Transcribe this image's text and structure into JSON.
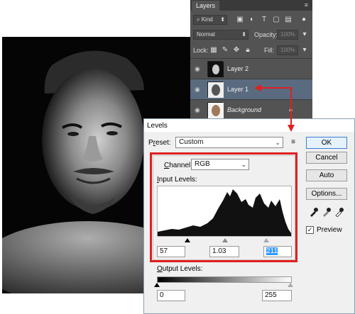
{
  "layers_panel": {
    "tab": "Layers",
    "filter_kind": "Kind",
    "blend_mode": "Normal",
    "opacity_label": "Opacity:",
    "opacity_value": "100%",
    "lock_label": "Lock:",
    "fill_label": "Fill:",
    "fill_value": "100%",
    "layers": [
      {
        "name": "Layer 2",
        "selected": false,
        "italic": false
      },
      {
        "name": "Layer 1",
        "selected": true,
        "italic": false
      },
      {
        "name": "Background",
        "selected": false,
        "italic": true
      }
    ]
  },
  "levels": {
    "title": "Levels",
    "preset_label_pre": "P",
    "preset_label_ul": "r",
    "preset_label_post": "eset:",
    "preset_value": "Custom",
    "channel_label_pre": "",
    "channel_label_ul": "C",
    "channel_label_post": "hannel:",
    "channel_value": "RGB",
    "input_levels_label_pre": "",
    "input_levels_label_ul": "I",
    "input_levels_label_post": "nput Levels:",
    "input_black": "57",
    "input_gamma": "1.03",
    "input_white": "211",
    "output_levels_label_pre": "",
    "output_levels_label_ul": "O",
    "output_levels_label_post": "utput Levels:",
    "output_black": "0",
    "output_white": "255",
    "buttons": {
      "ok": "OK",
      "cancel": "Cancel",
      "auto": "Auto",
      "options": "Options..."
    },
    "preview_label": "Preview",
    "preview_checked": true
  }
}
